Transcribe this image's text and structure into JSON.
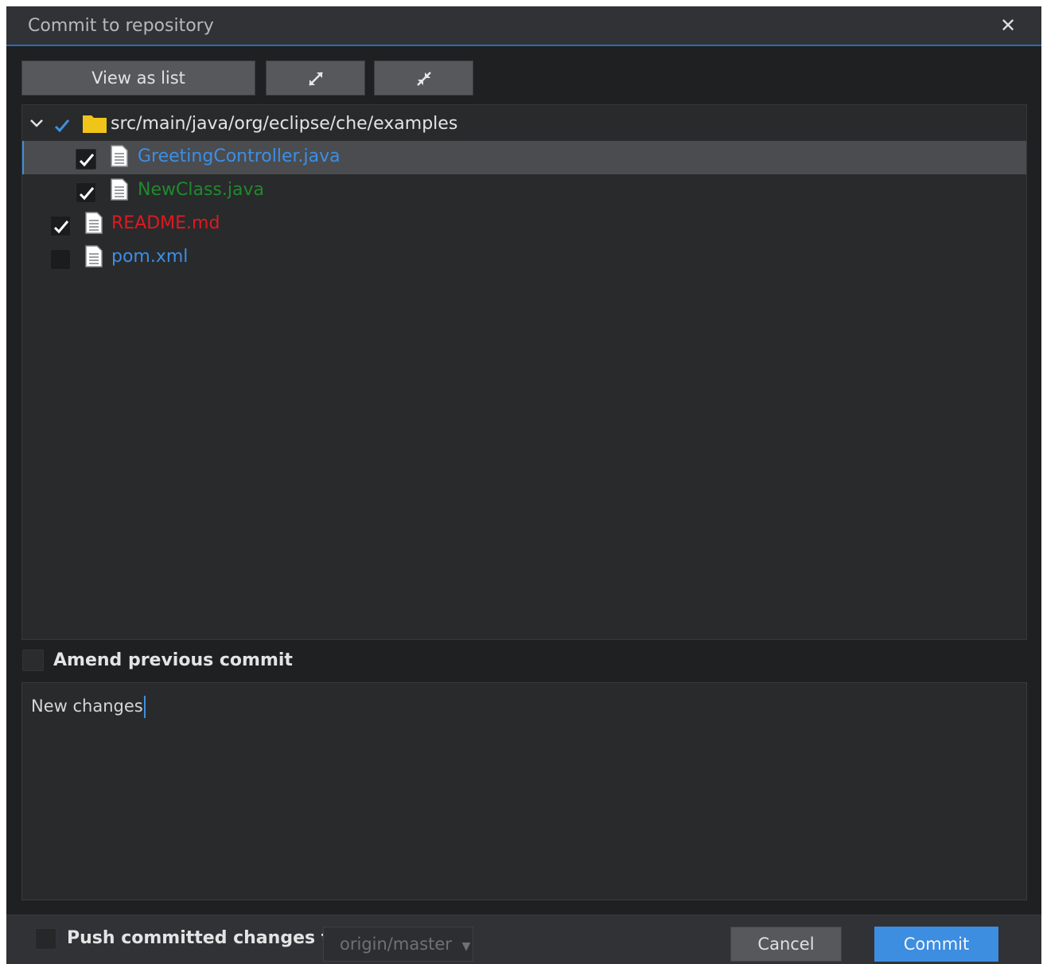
{
  "dialog": {
    "title": "Commit to repository",
    "close_icon": "close-icon"
  },
  "toolbar": {
    "view_as_list_label": "View as list",
    "expand_icon": "expand-icon",
    "collapse_icon": "collapse-icon"
  },
  "tree": {
    "folder": {
      "path": "src/main/java/org/eclipse/che/examples",
      "checked": true,
      "expanded": true,
      "icon": "folder-icon"
    },
    "files": [
      {
        "name": "GreetingController.java",
        "checked": true,
        "selected": true,
        "color": "#3b8fe6"
      },
      {
        "name": "NewClass.java",
        "checked": true,
        "selected": false,
        "color": "#1f8a2c"
      },
      {
        "name": "README.md",
        "checked": true,
        "selected": false,
        "color": "#e0191f"
      },
      {
        "name": "pom.xml",
        "checked": false,
        "selected": false,
        "color": "#3b8fe6"
      }
    ]
  },
  "amend": {
    "label": "Amend previous commit",
    "checked": false
  },
  "message": {
    "value": "New changes"
  },
  "footer": {
    "push_label": "Push committed changes to :",
    "push_checked": false,
    "remote_selected": "origin/master",
    "cancel_label": "Cancel",
    "commit_label": "Commit"
  },
  "colors": {
    "accent": "#3d8de0",
    "folder": "#f0c419",
    "checkmark": "#3e8fe0"
  }
}
